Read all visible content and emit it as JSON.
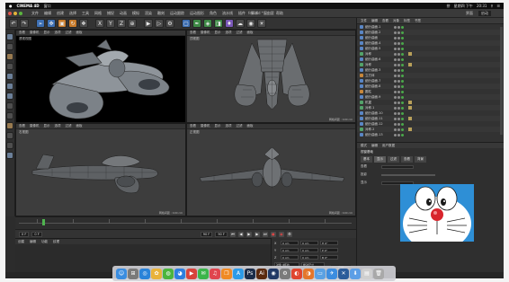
{
  "menubar": {
    "apple": "",
    "app_name": "CINEMA 4D",
    "items": [
      "窗口"
    ],
    "right_items": [
      "拼",
      "星期四 下午",
      "20:31"
    ]
  },
  "app_menu": {
    "items": [
      "文件",
      "编辑",
      "创建",
      "选择",
      "工具",
      "网格",
      "捕捉",
      "动画",
      "模拟",
      "渲染",
      "雕刻",
      "运动跟踪",
      "运动图形",
      "角色",
      "流水线",
      "插件",
      "脚本",
      "窗口",
      "帮助"
    ],
    "title": "fei.c4d * - 主要",
    "layout_label": "界面",
    "layout_value": "启动"
  },
  "viewports": {
    "perspective": {
      "menu": [
        "查看",
        "摄像机",
        "显示",
        "选项",
        "过滤",
        "面板"
      ],
      "label": "透视视图",
      "footer": ""
    },
    "top": {
      "menu": [
        "查看",
        "摄像机",
        "显示",
        "选项",
        "过滤",
        "面板"
      ],
      "label": "顶视图",
      "footer": "网格间距 : 100 cm"
    },
    "right": {
      "menu": [
        "查看",
        "摄像机",
        "显示",
        "选项",
        "过滤",
        "面板"
      ],
      "label": "右视图",
      "footer": "网格间距 : 100 cm"
    },
    "front": {
      "menu": [
        "查看",
        "摄像机",
        "显示",
        "选项",
        "过滤",
        "面板"
      ],
      "label": "正视图",
      "footer": "网格间距 : 100 cm"
    }
  },
  "timeline": {
    "frame_start": "0 F",
    "frame_current": "0 F",
    "frame_end": "90 F",
    "frame_end2": "90 F"
  },
  "materials": {
    "menu": [
      "创建",
      "编辑",
      "功能",
      "纹理"
    ]
  },
  "coords": {
    "rows": [
      {
        "axis": "X",
        "pos": "0 cm",
        "size": "0 cm",
        "rot": "H 0°"
      },
      {
        "axis": "Y",
        "pos": "0 cm",
        "size": "0 cm",
        "rot": "P 0°"
      },
      {
        "axis": "Z",
        "pos": "0 cm",
        "size": "0 cm",
        "rot": "B 0°"
      }
    ],
    "mode1": "对象 (相对)",
    "mode2": "绝对尺寸",
    "apply": "应用"
  },
  "object_manager": {
    "menu": [
      "文件",
      "编辑",
      "查看",
      "对象",
      "标签",
      "书签"
    ],
    "objects": [
      {
        "name": "细分曲面.1",
        "icon": "blue",
        "tag": false
      },
      {
        "name": "细分曲面.2",
        "icon": "blue",
        "tag": false
      },
      {
        "name": "细分曲面",
        "icon": "blue",
        "tag": false
      },
      {
        "name": "细分曲面.4",
        "icon": "blue",
        "tag": false
      },
      {
        "name": "细分曲面.5",
        "icon": "blue",
        "tag": false
      },
      {
        "name": "对称",
        "icon": "green",
        "tag": true
      },
      {
        "name": "细分曲面.6",
        "icon": "blue",
        "tag": false
      },
      {
        "name": "对称",
        "icon": "green",
        "tag": true
      },
      {
        "name": "细分曲面.3",
        "icon": "blue",
        "tag": false
      },
      {
        "name": "立方体",
        "icon": "orange",
        "tag": false
      },
      {
        "name": "细分曲面.7",
        "icon": "blue",
        "tag": false
      },
      {
        "name": "细分曲面.8",
        "icon": "blue",
        "tag": false
      },
      {
        "name": "圆柱",
        "icon": "orange",
        "tag": false
      },
      {
        "name": "细分曲面.9",
        "icon": "blue",
        "tag": false
      },
      {
        "name": "机翼",
        "icon": "green",
        "tag": true
      },
      {
        "name": "对称.1",
        "icon": "green",
        "tag": true
      },
      {
        "name": "细分曲面.10",
        "icon": "blue",
        "tag": false
      },
      {
        "name": "细分曲面.11",
        "icon": "blue",
        "tag": true
      },
      {
        "name": "细分曲面.12",
        "icon": "blue",
        "tag": false
      },
      {
        "name": "对称.2",
        "icon": "green",
        "tag": true
      },
      {
        "name": "细分曲面.13",
        "icon": "blue",
        "tag": false
      }
    ]
  },
  "attribute_manager": {
    "menu": [
      "模式",
      "编辑",
      "用户数据"
    ],
    "title": "视窗基础",
    "tabs": [
      "基本",
      "显示",
      "过滤",
      "查看",
      "背景"
    ],
    "rows": [
      "查看",
      "投影",
      "显示"
    ]
  },
  "statusbar": {
    "text": ""
  },
  "dock_icons": [
    {
      "name": "finder-icon",
      "color": "#3a8de0",
      "glyph": "☺"
    },
    {
      "name": "launchpad-icon",
      "color": "#7a7a7a",
      "glyph": "⊞"
    },
    {
      "name": "safari-icon",
      "color": "#2a83d9",
      "glyph": "◎"
    },
    {
      "name": "photos-icon",
      "color": "#e9b33a",
      "glyph": "✿"
    },
    {
      "name": "wechat-icon",
      "color": "#4bb53d",
      "glyph": "◍"
    },
    {
      "name": "qq-icon",
      "color": "#2d7fe0",
      "glyph": "◕"
    },
    {
      "name": "video-icon",
      "color": "#d8433c",
      "glyph": "▶"
    },
    {
      "name": "message-icon",
      "color": "#3bb54a",
      "glyph": "✉"
    },
    {
      "name": "music-icon",
      "color": "#e0454e",
      "glyph": "♫"
    },
    {
      "name": "books-icon",
      "color": "#f08a24",
      "glyph": "❒"
    },
    {
      "name": "appstore-icon",
      "color": "#2d9be8",
      "glyph": "A"
    },
    {
      "name": "photoshop-icon",
      "color": "#1b2d4a",
      "glyph": "Ps"
    },
    {
      "name": "illustrator-icon",
      "color": "#5b2a0f",
      "glyph": "Ai"
    },
    {
      "name": "cinema4d-icon",
      "color": "#223a66",
      "glyph": "◉"
    },
    {
      "name": "settings-icon",
      "color": "#7b7b7b",
      "glyph": "⚙"
    },
    {
      "name": "chrome-icon",
      "color": "#e0462f",
      "glyph": "◐"
    },
    {
      "name": "firefox-icon",
      "color": "#e4762a",
      "glyph": "◑"
    },
    {
      "name": "folder-icon",
      "color": "#5aa1e3",
      "glyph": "▭"
    },
    {
      "name": "mail-icon",
      "color": "#3c8de0",
      "glyph": "✈"
    },
    {
      "name": "xcode-icon",
      "color": "#2b5c9a",
      "glyph": "✕"
    },
    {
      "name": "download-icon",
      "color": "#5c9ee6",
      "glyph": "⬇"
    },
    {
      "name": "preview-icon",
      "color": "#cfcfcf",
      "glyph": "▤"
    },
    {
      "name": "trash-icon",
      "color": "#a9a9a9",
      "glyph": "🗑"
    }
  ]
}
